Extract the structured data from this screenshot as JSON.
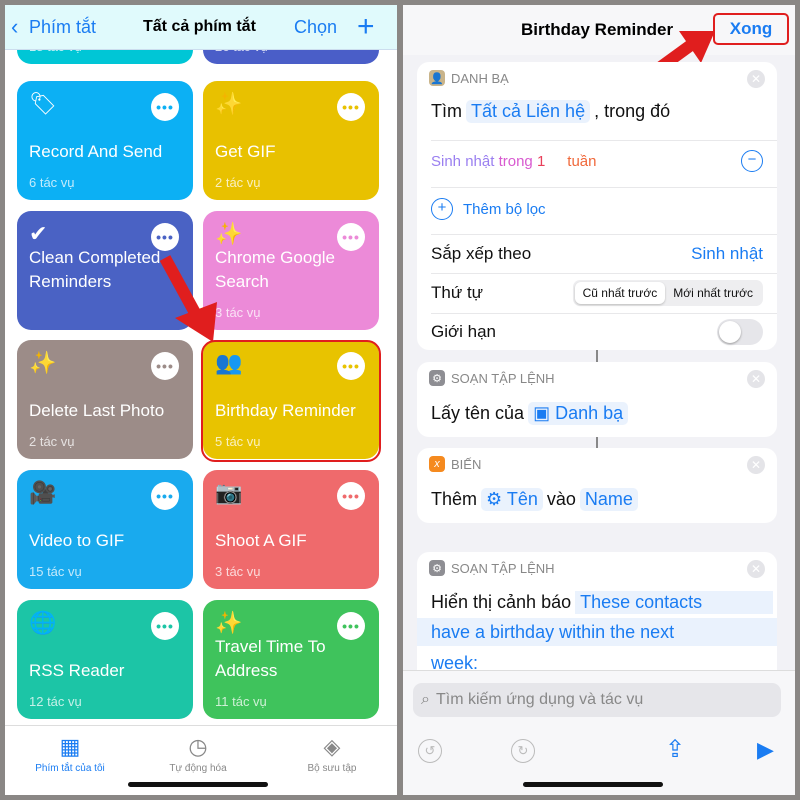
{
  "left": {
    "nav": {
      "back": "Phím tắt",
      "title": "Tất cả phím tắt",
      "select": "Chọn",
      "add": "+"
    },
    "partial": [
      {
        "count": "18 tác vụ",
        "color": "#00c6d6"
      },
      {
        "count": "26 tác vụ",
        "color": "#4a5ec8"
      }
    ],
    "tiles": [
      {
        "name": "Record And Send",
        "count": "6 tác vụ",
        "color": "#0cb0f4",
        "icon": "tag-icon",
        "glyph": "🏷"
      },
      {
        "name": "Get GIF",
        "count": "2 tác vụ",
        "color": "#e8c100",
        "icon": "magic-wand-icon",
        "glyph": "✨"
      },
      {
        "name": "Clean Completed Reminders",
        "count": "",
        "color": "#4a62c4",
        "icon": "checkmark-circle-icon",
        "glyph": "✔"
      },
      {
        "name": "Chrome Google Search",
        "count": "3 tác vụ",
        "color": "#ec8ad8",
        "icon": "magic-wand-icon",
        "glyph": "✨"
      },
      {
        "name": "Delete Last Photo",
        "count": "2 tác vụ",
        "color": "#9c8c88",
        "icon": "magic-wand-icon",
        "glyph": "✨"
      },
      {
        "name": "Birthday Reminder",
        "count": "5 tác vụ",
        "color": "#e8c300",
        "icon": "people-icon",
        "glyph": "👥"
      },
      {
        "name": "Video to GIF",
        "count": "15 tác vụ",
        "color": "#19aaee",
        "icon": "video-camera-icon",
        "glyph": "🎥"
      },
      {
        "name": "Shoot A GIF",
        "count": "3 tác vụ",
        "color": "#ef6a6c",
        "icon": "camera-icon",
        "glyph": "📷"
      },
      {
        "name": "RSS Reader",
        "count": "12 tác vụ",
        "color": "#1cc5a6",
        "icon": "globe-icon",
        "glyph": "🌐"
      },
      {
        "name": "Travel Time To Address",
        "count": "11 tác vụ",
        "color": "#3fc35c",
        "icon": "magic-wand-icon",
        "glyph": "✨"
      }
    ],
    "tabs": [
      {
        "label": "Phím tắt của tôi",
        "active": true
      },
      {
        "label": "Tự động hóa"
      },
      {
        "label": "Bộ sưu tập"
      }
    ]
  },
  "right": {
    "nav": {
      "title": "Birthday Reminder",
      "done": "Xong"
    },
    "card1": {
      "header": "DANH BẠ",
      "find": "Tìm",
      "all_contacts": "Tất cả Liên hệ",
      "where": ", trong đó",
      "filter": {
        "field": "Sinh nhật",
        "op": "trong",
        "num": "1",
        "unit": "tuần"
      },
      "add_filter": "Thêm bộ lọc",
      "sort_label": "Sắp xếp theo",
      "sort_value": "Sinh nhật",
      "order_label": "Thứ tự",
      "order_options": [
        "Cũ nhất trước",
        "Mới nhất trước"
      ],
      "order_selected": "Cũ nhất trước",
      "limit_label": "Giới hạn",
      "limit_on": false
    },
    "card2": {
      "header": "SOẠN TẬP LỆNH",
      "text": "Lấy tên của",
      "token": "Danh bạ"
    },
    "card3": {
      "header": "BIẾN",
      "add": "Thêm",
      "token": "Tên",
      "into": "vào",
      "var": "Name"
    },
    "card4": {
      "header": "SOẠN TẬP LỆNH",
      "text": "Hiển thị cảnh báo",
      "line1": "These contacts",
      "line2": "have a birthday within the next",
      "line3": "week:"
    },
    "search_placeholder": "Tìm kiếm ứng dụng và tác vụ"
  }
}
